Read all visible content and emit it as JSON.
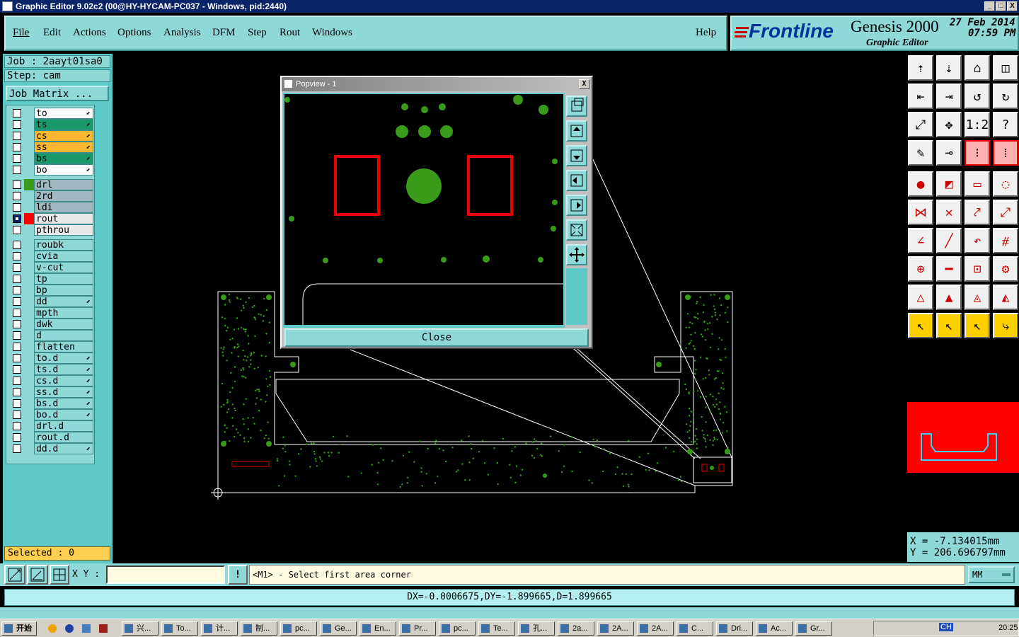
{
  "window": {
    "title": "Graphic Editor 9.02c2 (00@HY-HYCAM-PC037 - Windows, pid:2440)",
    "min": "_",
    "max": "□",
    "close": "X"
  },
  "menu": {
    "items": [
      "File",
      "Edit",
      "Actions",
      "Options",
      "Analysis",
      "DFM",
      "Step",
      "Rout",
      "Windows"
    ],
    "help": "Help"
  },
  "brand": {
    "logo": "Frontline",
    "product": "Genesis 2000",
    "subtitle": "Graphic Editor",
    "date": "27 Feb 2014",
    "time": "07:59 PM"
  },
  "job": {
    "job_label": "Job : 2aayt01sa0",
    "step_label": "Step: cam",
    "matrix_button": "Job Matrix ..."
  },
  "layers_group1": [
    {
      "name": "to",
      "color": "#ffffff",
      "arrow": true
    },
    {
      "name": "ts",
      "color": "#1a9a6a",
      "arrow": true
    },
    {
      "name": "cs",
      "color": "#ffb830",
      "arrow": true
    },
    {
      "name": "ss",
      "color": "#ffb830",
      "arrow": true
    },
    {
      "name": "bs",
      "color": "#1a9a6a",
      "arrow": true
    },
    {
      "name": "bo",
      "color": "#ffffff",
      "arrow": true
    }
  ],
  "layers_group2": [
    {
      "name": "drl",
      "color": "#a0b8c0",
      "swatch": "#3a9a1a"
    },
    {
      "name": "2rd",
      "color": "#a0b8c0"
    },
    {
      "name": "ldi",
      "color": "#a0b8c0"
    },
    {
      "name": "rout",
      "color": "#e8e8e8",
      "swatch": "#ff0000",
      "checked": true
    },
    {
      "name": "pthrou",
      "color": "#e8e8e8"
    }
  ],
  "layers_group3": [
    {
      "name": "roubk"
    },
    {
      "name": "cvia"
    },
    {
      "name": "v-cut"
    },
    {
      "name": "tp"
    },
    {
      "name": "bp"
    },
    {
      "name": "dd",
      "arrow": true
    },
    {
      "name": "mpth"
    },
    {
      "name": "dwk"
    },
    {
      "name": "d"
    },
    {
      "name": "flatten"
    },
    {
      "name": "to.d",
      "arrow": true
    },
    {
      "name": "ts.d",
      "arrow": true
    },
    {
      "name": "cs.d",
      "arrow": true
    },
    {
      "name": "ss.d",
      "arrow": true
    },
    {
      "name": "bs.d",
      "arrow": true
    },
    {
      "name": "bo.d",
      "arrow": true
    },
    {
      "name": "drl.d"
    },
    {
      "name": "rout.d"
    },
    {
      "name": "dd.d",
      "arrow": true
    }
  ],
  "selected": "Selected : 0",
  "coords": {
    "x": "X  = -7.134015mm",
    "y": "Y  = 206.696797mm"
  },
  "input": {
    "label": "X Y :",
    "value": "",
    "prompt": "<M1> - Select first area corner",
    "units": "MM"
  },
  "status": "DX=-0.0006675,DY=-1.899665,D=1.899665",
  "popview": {
    "title": "Popview - 1",
    "close_button": "Close",
    "close_x": "X"
  },
  "taskbar": {
    "start": "开始",
    "tasks": [
      "兴...",
      "To...",
      "计...",
      "制...",
      "pc...",
      "Ge...",
      "En...",
      "Pr...",
      "pc...",
      "Te...",
      "孔...",
      "2a...",
      "2A...",
      "2A...",
      "C...",
      "Dri...",
      "Ac...",
      "Gr..."
    ],
    "clock": "20:25",
    "tray": "CH"
  },
  "colors": {
    "accent": "#8ed8d8",
    "title": "#0a246a",
    "pads": "#3a9a1a",
    "rout": "#ff0000"
  }
}
